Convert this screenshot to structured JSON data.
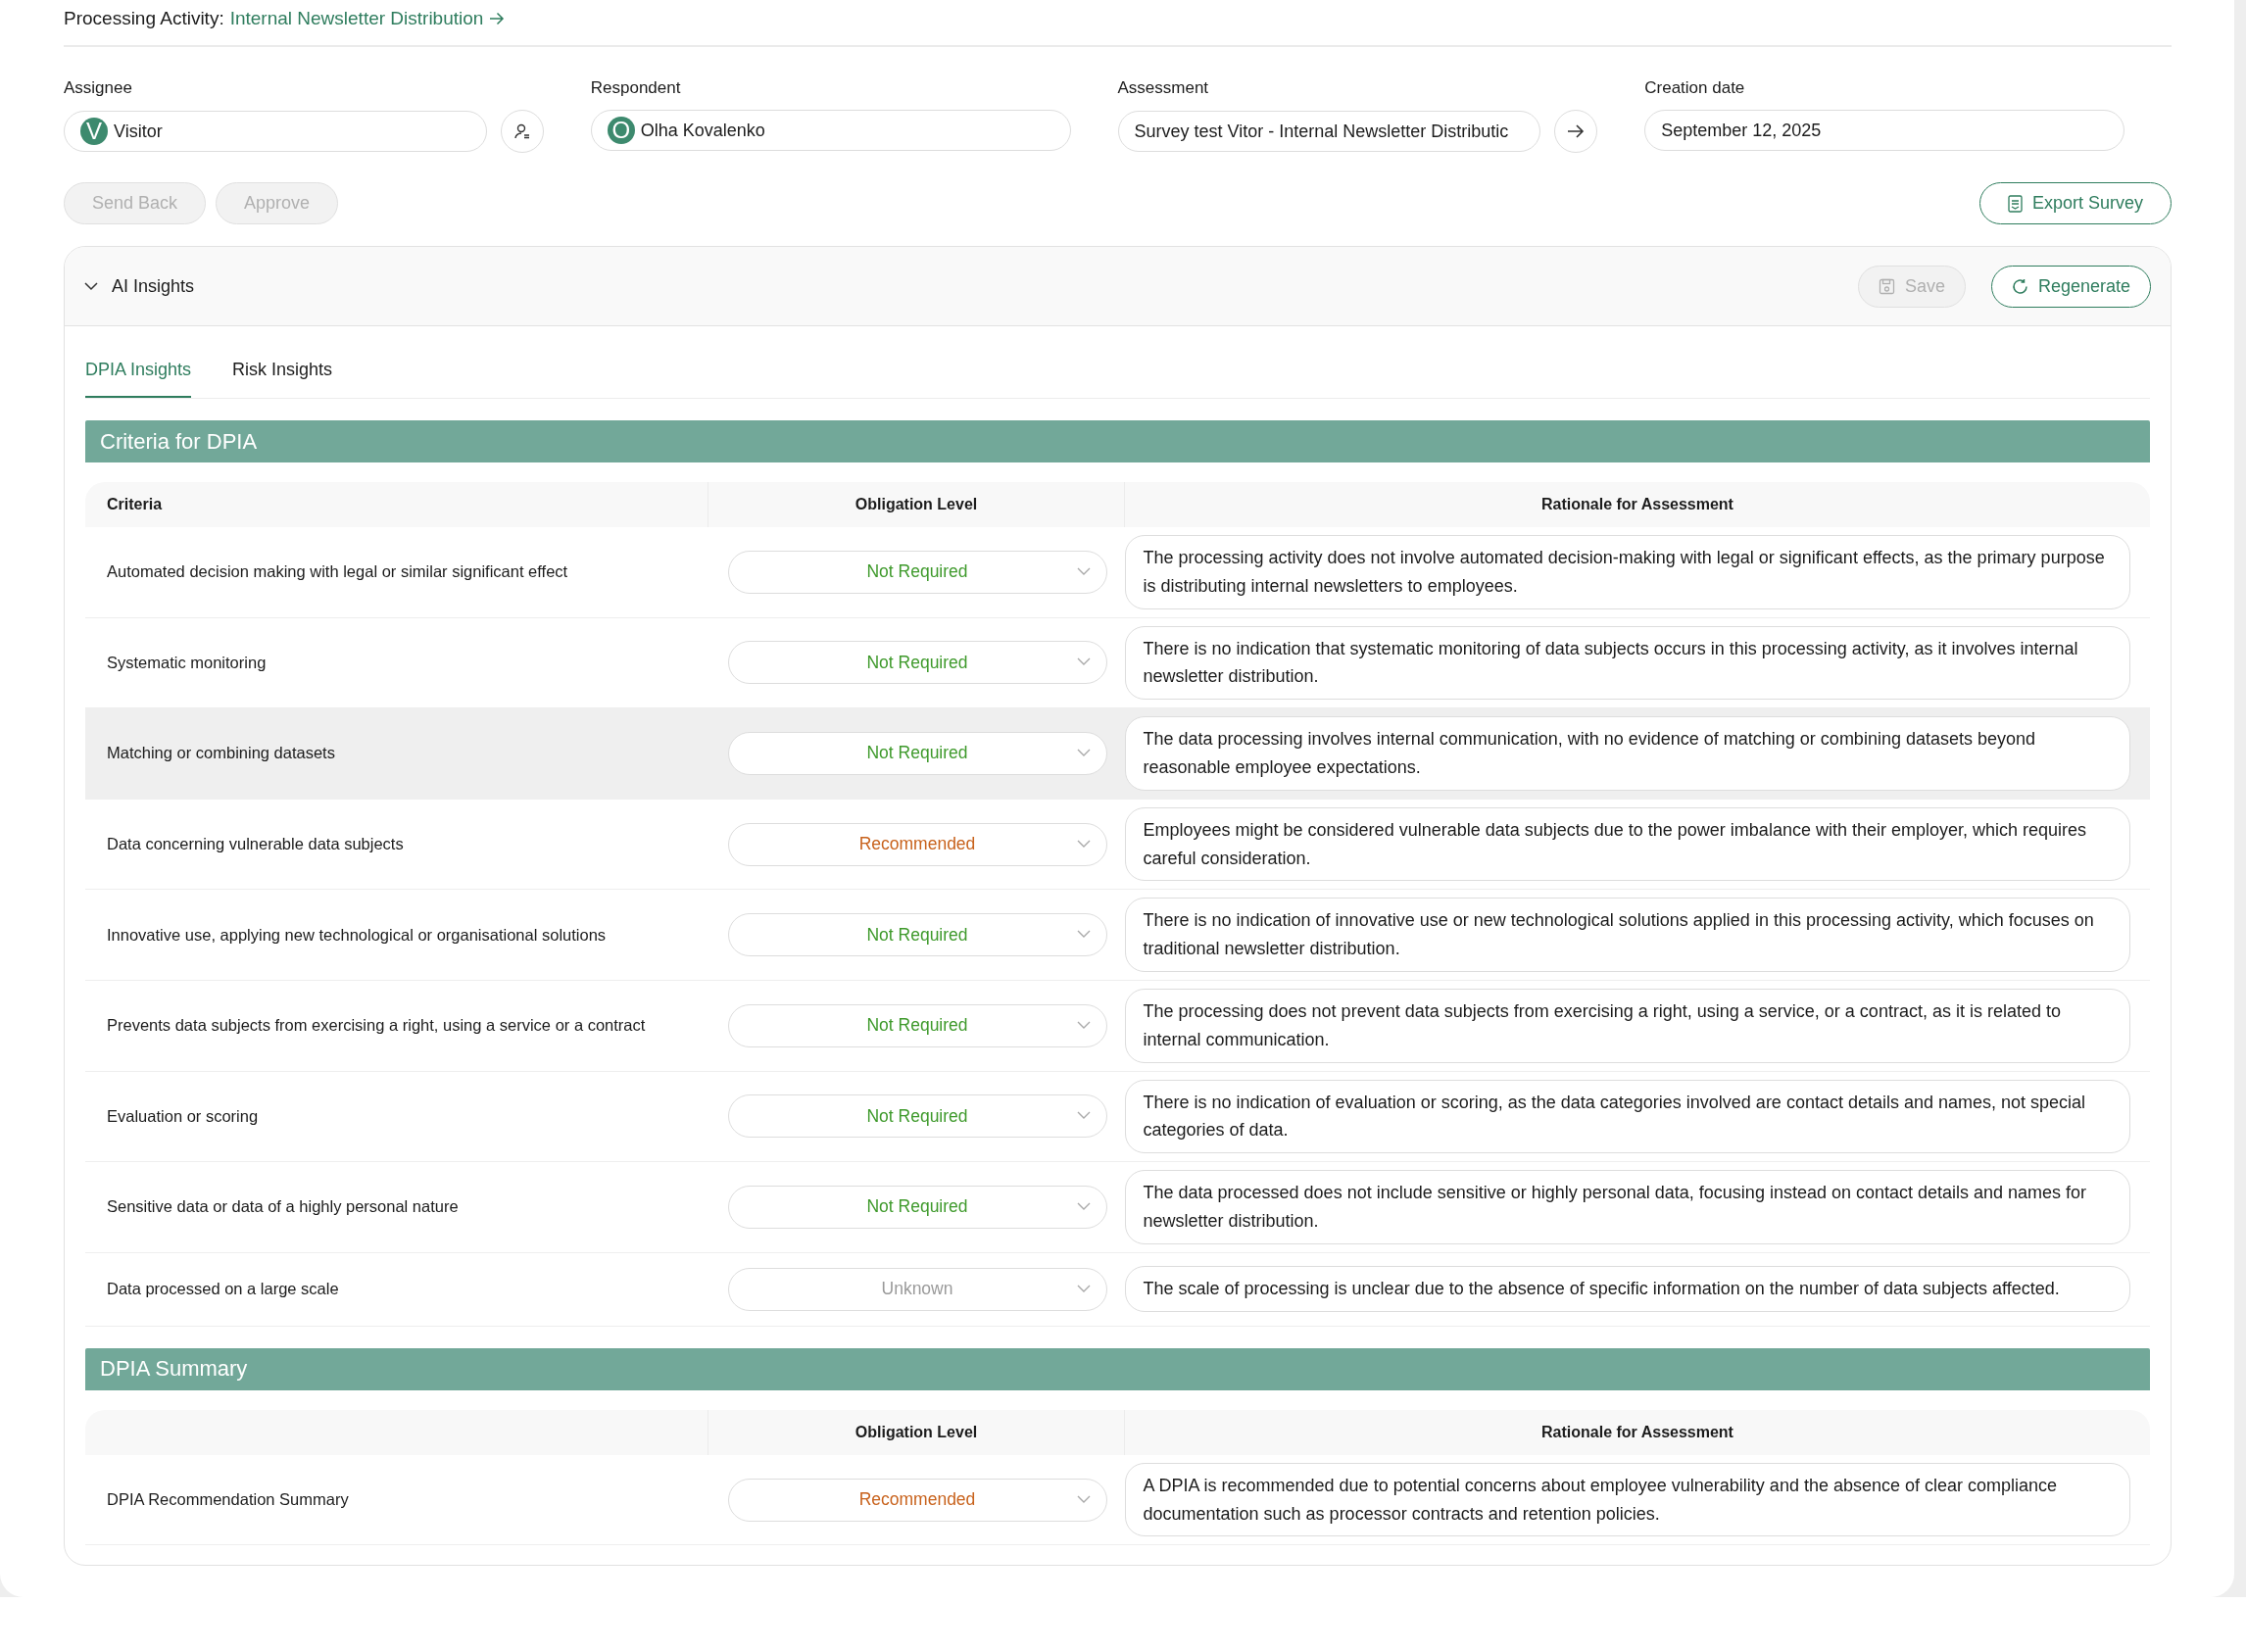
{
  "header": {
    "label": "Processing Activity:",
    "link": "Internal Newsletter Distribution"
  },
  "fields": [
    {
      "label": "Assignee",
      "avatar": "V",
      "value": "Visitor",
      "button": {
        "kind": "reassign"
      }
    },
    {
      "label": "Respondent",
      "avatar": "O",
      "value": "Olha Kovalenko"
    },
    {
      "label": "Assessment",
      "value": "Survey test Vitor - Internal Newsletter Distributic",
      "button": {
        "kind": "open"
      }
    },
    {
      "label": "Creation date",
      "value": "September 12, 2025"
    }
  ],
  "actions": [
    {
      "label": "Send Back",
      "disabled": true
    },
    {
      "label": "Approve",
      "disabled": true
    }
  ],
  "export_button": {
    "label": "Export Survey",
    "disabled": false
  },
  "insights": {
    "title": "AI Insights",
    "expanded": true,
    "buttons": [
      {
        "kind": "save",
        "label": "Save",
        "disabled": true
      },
      {
        "kind": "regenerate",
        "label": "Regenerate",
        "disabled": false
      }
    ],
    "tabs": [
      {
        "label": "DPIA Insights",
        "selected": true
      },
      {
        "label": "Risk Insights",
        "selected": false
      }
    ],
    "sections": [
      {
        "title": "Criteria for DPIA",
        "columns": [
          "Criteria",
          "Obligation Level",
          "Rationale for Assessment"
        ],
        "rows": [
          {
            "criteria": "Automated decision making with legal or similar significant effect",
            "level": "Not Required",
            "color": "#3f9a2c",
            "highlighted": false,
            "rationale": "The processing activity does not involve automated decision-making with legal or significant effects, as the primary purpose is distributing internal newsletters to employees."
          },
          {
            "criteria": "Systematic monitoring",
            "level": "Not Required",
            "color": "#3f9a2c",
            "highlighted": false,
            "rationale": "There is no indication that systematic monitoring of data subjects occurs in this processing activity, as it involves internal newsletter distribution."
          },
          {
            "criteria": "Matching or combining datasets",
            "level": "Not Required",
            "color": "#3f9a2c",
            "highlighted": true,
            "rationale": "The data processing involves internal communication, with no evidence of matching or combining datasets beyond reasonable employee expectations."
          },
          {
            "criteria": "Data concerning vulnerable data subjects",
            "level": "Recommended",
            "color": "#c8621c",
            "highlighted": false,
            "rationale": "Employees might be considered vulnerable data subjects due to the power imbalance with their employer, which requires careful consideration."
          },
          {
            "criteria": "Innovative use, applying new technological or organisational solutions",
            "level": "Not Required",
            "color": "#3f9a2c",
            "highlighted": false,
            "rationale": "There is no indication of innovative use or new technological solutions applied in this processing activity, which focuses on traditional newsletter distribution."
          },
          {
            "criteria": "Prevents data subjects from exercising a right, using a service or a contract",
            "level": "Not Required",
            "color": "#3f9a2c",
            "highlighted": false,
            "rationale": "The processing does not prevent data subjects from exercising a right, using a service, or a contract, as it is related to internal communication."
          },
          {
            "criteria": "Evaluation or scoring",
            "level": "Not Required",
            "color": "#3f9a2c",
            "highlighted": false,
            "rationale": "There is no indication of evaluation or scoring, as the data categories involved are contact details and names, not special categories of data."
          },
          {
            "criteria": "Sensitive data or data of a highly personal nature",
            "level": "Not Required",
            "color": "#3f9a2c",
            "highlighted": false,
            "rationale": "The data processed does not include sensitive or highly personal data, focusing instead on contact details and names for newsletter distribution."
          },
          {
            "criteria": "Data processed on a large scale",
            "level": "Unknown",
            "color": "#9a9a9a",
            "highlighted": false,
            "rationale": "The scale of processing is unclear due to the absence of specific information on the number of data subjects affected."
          }
        ]
      },
      {
        "title": "DPIA Summary",
        "columns": [
          "",
          "Obligation Level",
          "Rationale for Assessment"
        ],
        "rows": [
          {
            "criteria": "DPIA Recommendation Summary",
            "level": "Recommended",
            "color": "#c8621c",
            "highlighted": false,
            "rationale": "A DPIA is recommended due to potential concerns about employee vulnerability and the absence of clear compliance documentation such as processor contracts and retention policies."
          }
        ]
      }
    ]
  }
}
